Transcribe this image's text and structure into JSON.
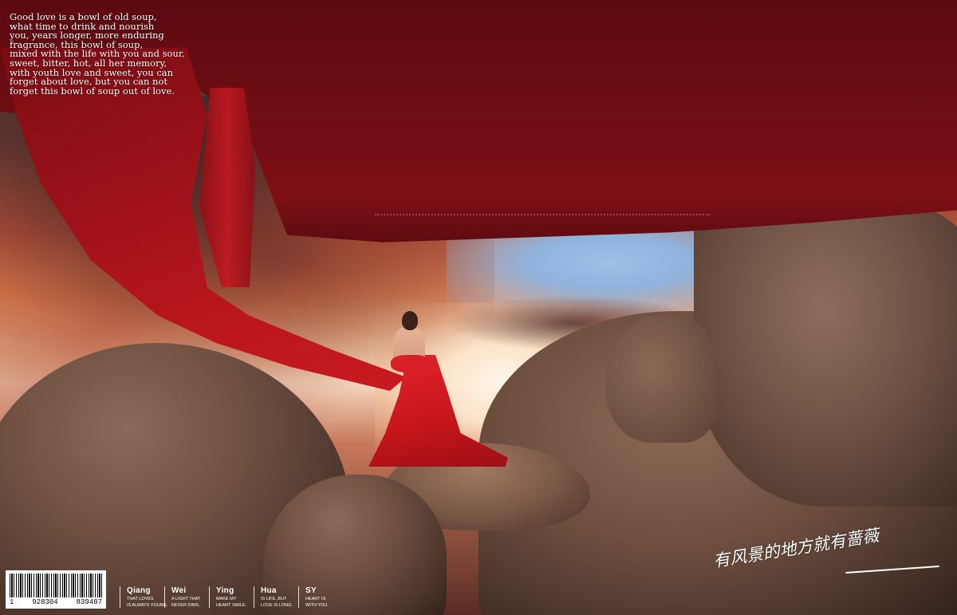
{
  "poem": {
    "lines": [
      "Good love is a bowl of old soup,",
      "what time to drink and nourish",
      "you, years longer, more enduring",
      " fragrance, this bowl of soup,",
      " mixed with the life with you and sour,",
      " sweet, bitter, hot, all her memory,",
      "with youth love and sweet, you can",
      " forget about love, but you can not",
      " forget this bowl of soup out of love."
    ]
  },
  "barcode": {
    "digit": "1",
    "group1": "928304",
    "group2": "839487"
  },
  "tags": [
    {
      "name": "Qiang",
      "sub1": "THAT LOVES",
      "sub2": "IS ALWAYS YOUNG."
    },
    {
      "name": "Wei",
      "sub1": "A LIGHT THAT",
      "sub2": "NEVER DIMS."
    },
    {
      "name": "Ying",
      "sub1": "MAKE MY",
      "sub2": "HEART SMILE."
    },
    {
      "name": "Hua",
      "sub1": "IS LIFE, BUT",
      "sub2": "LOVE IS LONG."
    },
    {
      "name": "SY",
      "sub1": "HEART IS",
      "sub2": "WITH YOU."
    }
  ],
  "script_text": "有风景的地方就有蔷薇",
  "colors": {
    "fabric": "#7d1016",
    "dress": "#d81f25",
    "rock": "#6d4f40",
    "text": "#ffffff"
  }
}
